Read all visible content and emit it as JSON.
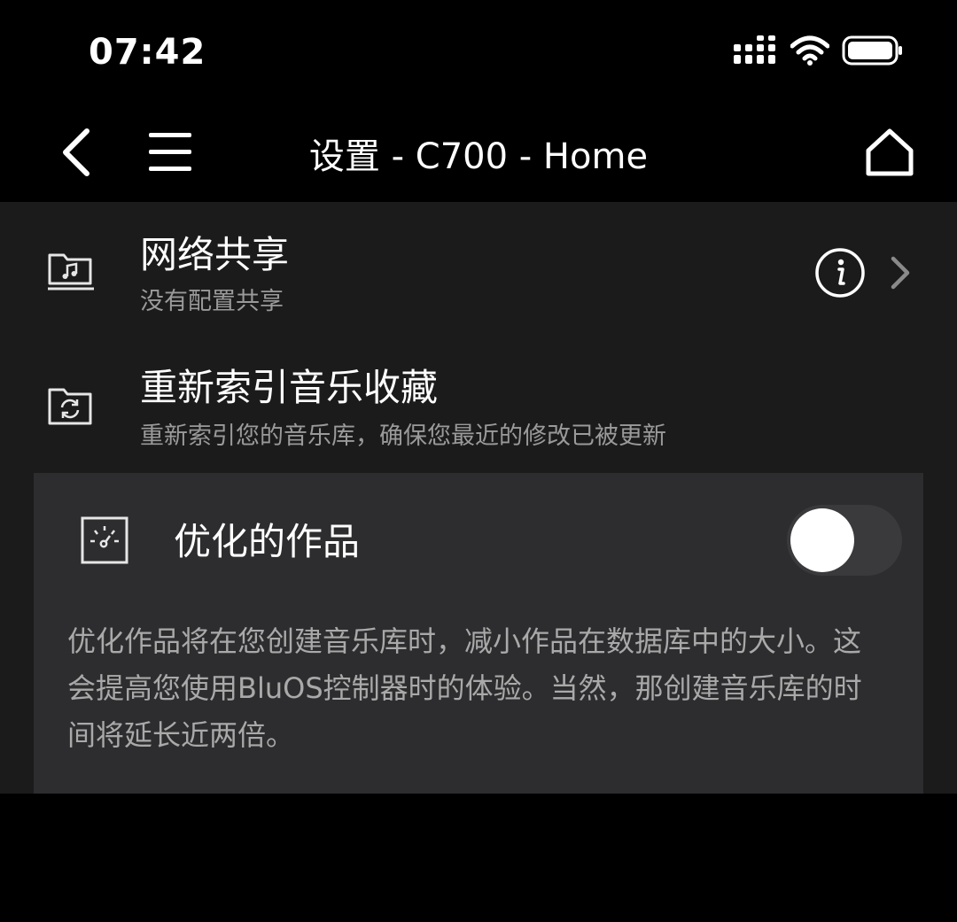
{
  "status_bar": {
    "time": "07:42",
    "icons": [
      "signal-icon",
      "wifi-icon",
      "battery-icon"
    ]
  },
  "header": {
    "title": "设置 - C700 - Home",
    "icons": [
      "back-arrow-icon",
      "hamburger-menu-icon",
      "home-icon"
    ]
  },
  "settings": {
    "network_share": {
      "title": "网络共享",
      "subtitle": "没有配置共享",
      "icon": "music-folder-icon"
    },
    "reindex": {
      "title": "重新索引音乐收藏",
      "subtitle": "重新索引您的音乐库，确保您最近的修改已被更新",
      "icon": "folder-refresh-icon"
    },
    "optimized_artwork": {
      "title": "优化的作品",
      "icon": "gauge-icon",
      "enabled": false,
      "description": "优化作品将在您创建音乐库时，减小作品在数据库中的大小。这会提高您使用BluOS控制器时的体验。当然，那创建音乐库的时间将延长近两倍。"
    }
  },
  "colors": {
    "background": "#000000",
    "content_background": "#1b1b1b",
    "panel_background": "#2d2d2f",
    "primary_text": "#ffffff",
    "secondary_text": "#9a9a9a",
    "toggle_track_off": "#3a3a3c"
  }
}
